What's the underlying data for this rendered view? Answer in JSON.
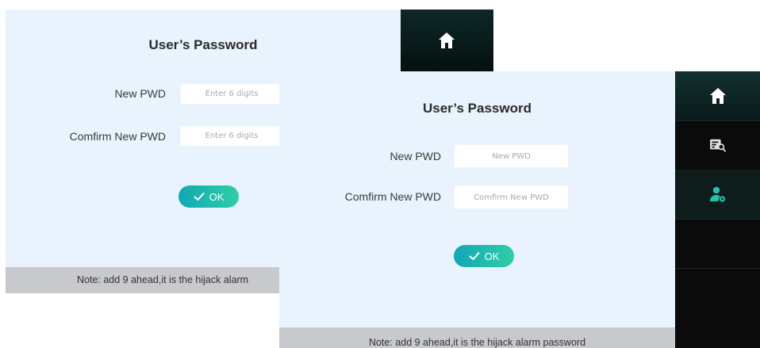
{
  "back_screen": {
    "title": "User’s Password",
    "new_pwd_label": "New PWD",
    "new_pwd_placeholder": "Enter 6 digits",
    "confirm_pwd_label": "Comfirm New PWD",
    "confirm_pwd_placeholder": "Enter 6 digits",
    "ok_label": "OK",
    "note": "Note:  add 9 ahead,it is the hijack alarm"
  },
  "front_screen": {
    "title": "User’s Password",
    "new_pwd_label": "New PWD",
    "new_pwd_placeholder": "New PWD",
    "confirm_pwd_label": "Comfirm New PWD",
    "confirm_pwd_placeholder": "Comfirm New PWD",
    "ok_label": "OK",
    "note": "Note:  add 9 ahead,it is the hijack alarm password"
  },
  "sidebar": {
    "items": [
      {
        "icon": "home-icon"
      },
      {
        "icon": "log-search-icon"
      },
      {
        "icon": "user-settings-icon"
      }
    ]
  },
  "colors": {
    "screen_bg": "#e8f3fd",
    "ok_gradient_start": "#12a7b5",
    "ok_gradient_end": "#2ecfa5",
    "sidebar_bg": "#0b0b0b",
    "accent_teal": "#1fc3a6"
  }
}
